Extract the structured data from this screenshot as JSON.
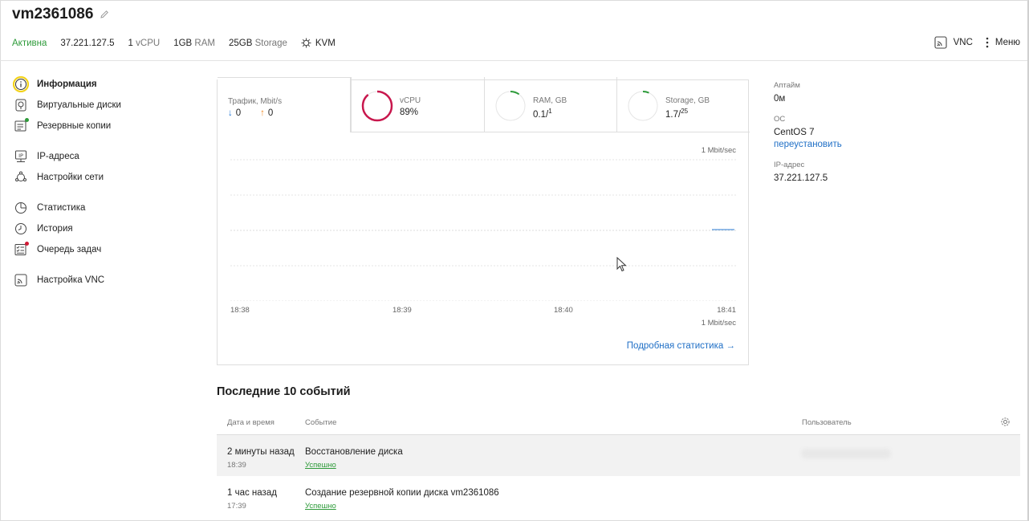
{
  "header": {
    "vm_name": "vm2361086",
    "status": "Активна",
    "ip": "37.221.127.5",
    "cpu_value": "1",
    "cpu_unit": "vCPU",
    "ram_value": "1GB",
    "ram_unit": "RAM",
    "storage_value": "25GB",
    "storage_unit": "Storage",
    "virt": "KVM",
    "vnc_label": "VNC",
    "menu_label": "Меню"
  },
  "sidebar": {
    "items": [
      {
        "label": "Информация",
        "icon": "info-icon"
      },
      {
        "label": "Виртуальные диски",
        "icon": "disk-icon"
      },
      {
        "label": "Резервные копии",
        "icon": "backup-icon"
      },
      {
        "label": "IP-адреса",
        "icon": "ip-icon"
      },
      {
        "label": "Настройки сети",
        "icon": "network-icon"
      },
      {
        "label": "Статистика",
        "icon": "pie-chart-icon"
      },
      {
        "label": "История",
        "icon": "clock-icon"
      },
      {
        "label": "Очередь задач",
        "icon": "task-list-icon"
      },
      {
        "label": "Настройка VNC",
        "icon": "vnc-icon"
      }
    ]
  },
  "stats": {
    "traffic": {
      "label": "Трафик, Mbit/s",
      "down": "0",
      "up": "0"
    },
    "vcpu": {
      "label": "vCPU",
      "value": "89%",
      "fraction": 0.89,
      "color": "#c8174d"
    },
    "ram": {
      "label": "RAM, GB",
      "value": "0.1/",
      "total": "1",
      "fraction": 0.1,
      "color": "#2e9b3a"
    },
    "storage": {
      "label": "Storage, GB",
      "value": "1.7/",
      "total": "25",
      "fraction": 0.068,
      "color": "#2e9b3a"
    },
    "scale_top": "1 Mbit/sec",
    "scale_bottom": "1 Mbit/sec",
    "x_ticks": [
      "18:38",
      "18:39",
      "18:40",
      "18:41"
    ],
    "detail_link": "Подробная статистика →"
  },
  "info": {
    "uptime_label": "Аптайм",
    "uptime_value": "0м",
    "os_label": "ОС",
    "os_value": "CentOS 7",
    "reinstall_link": "переустановить",
    "ip_label": "IP-адрес",
    "ip_value": "37.221.127.5"
  },
  "events": {
    "title": "Последние 10 событий",
    "columns": {
      "datetime": "Дата и время",
      "event": "Событие",
      "user": "Пользователь"
    },
    "rows": [
      {
        "when": "2 минуты назад",
        "time": "18:39",
        "event": "Восстановление диска",
        "status": "Успешно"
      },
      {
        "when": "1 час назад",
        "time": "17:39",
        "event": "Создание резервной копии диска vm2361086",
        "status": "Успешно"
      }
    ]
  }
}
